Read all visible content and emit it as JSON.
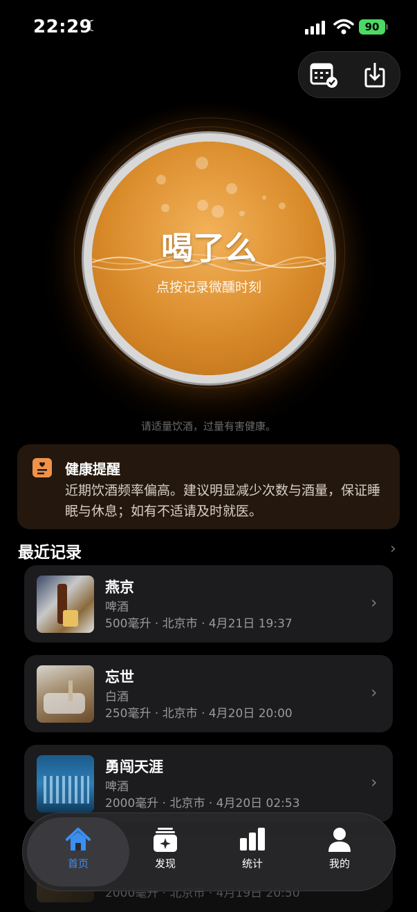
{
  "status": {
    "time": "22:29",
    "battery": "90"
  },
  "main": {
    "title": "喝了么",
    "subtitle": "点按记录微醺时刻",
    "advice": "请适量饮酒，过量有害健康。"
  },
  "health": {
    "title": "健康提醒",
    "body": "近期饮酒频率偏高。建议明显减少次数与酒量，保证睡眠与休息；如有不适请及时就医。"
  },
  "recent": {
    "title": "最近记录",
    "records": [
      {
        "name": "燕京",
        "type": "啤酒",
        "meta": "500毫升 · 北京市 · 4月21日 19:37"
      },
      {
        "name": "忘世",
        "type": "白酒",
        "meta": "250毫升 · 北京市 · 4月20日 20:00"
      },
      {
        "name": "勇闯天涯",
        "type": "啤酒",
        "meta": "2000毫升 · 北京市 · 4月20日 02:53"
      },
      {
        "name": "",
        "type": "",
        "meta": "2000毫升 · 北京市 · 4月19日 20:50"
      }
    ]
  },
  "tabs": [
    {
      "label": "首页",
      "icon": "home-icon",
      "active": true
    },
    {
      "label": "发现",
      "icon": "discover-icon",
      "active": false
    },
    {
      "label": "统计",
      "icon": "stats-icon",
      "active": false
    },
    {
      "label": "我的",
      "icon": "profile-icon",
      "active": false
    }
  ],
  "colors": {
    "accent": "#3b8ff0",
    "amber": "#d98b2a",
    "health_icon": "#f0924a"
  }
}
